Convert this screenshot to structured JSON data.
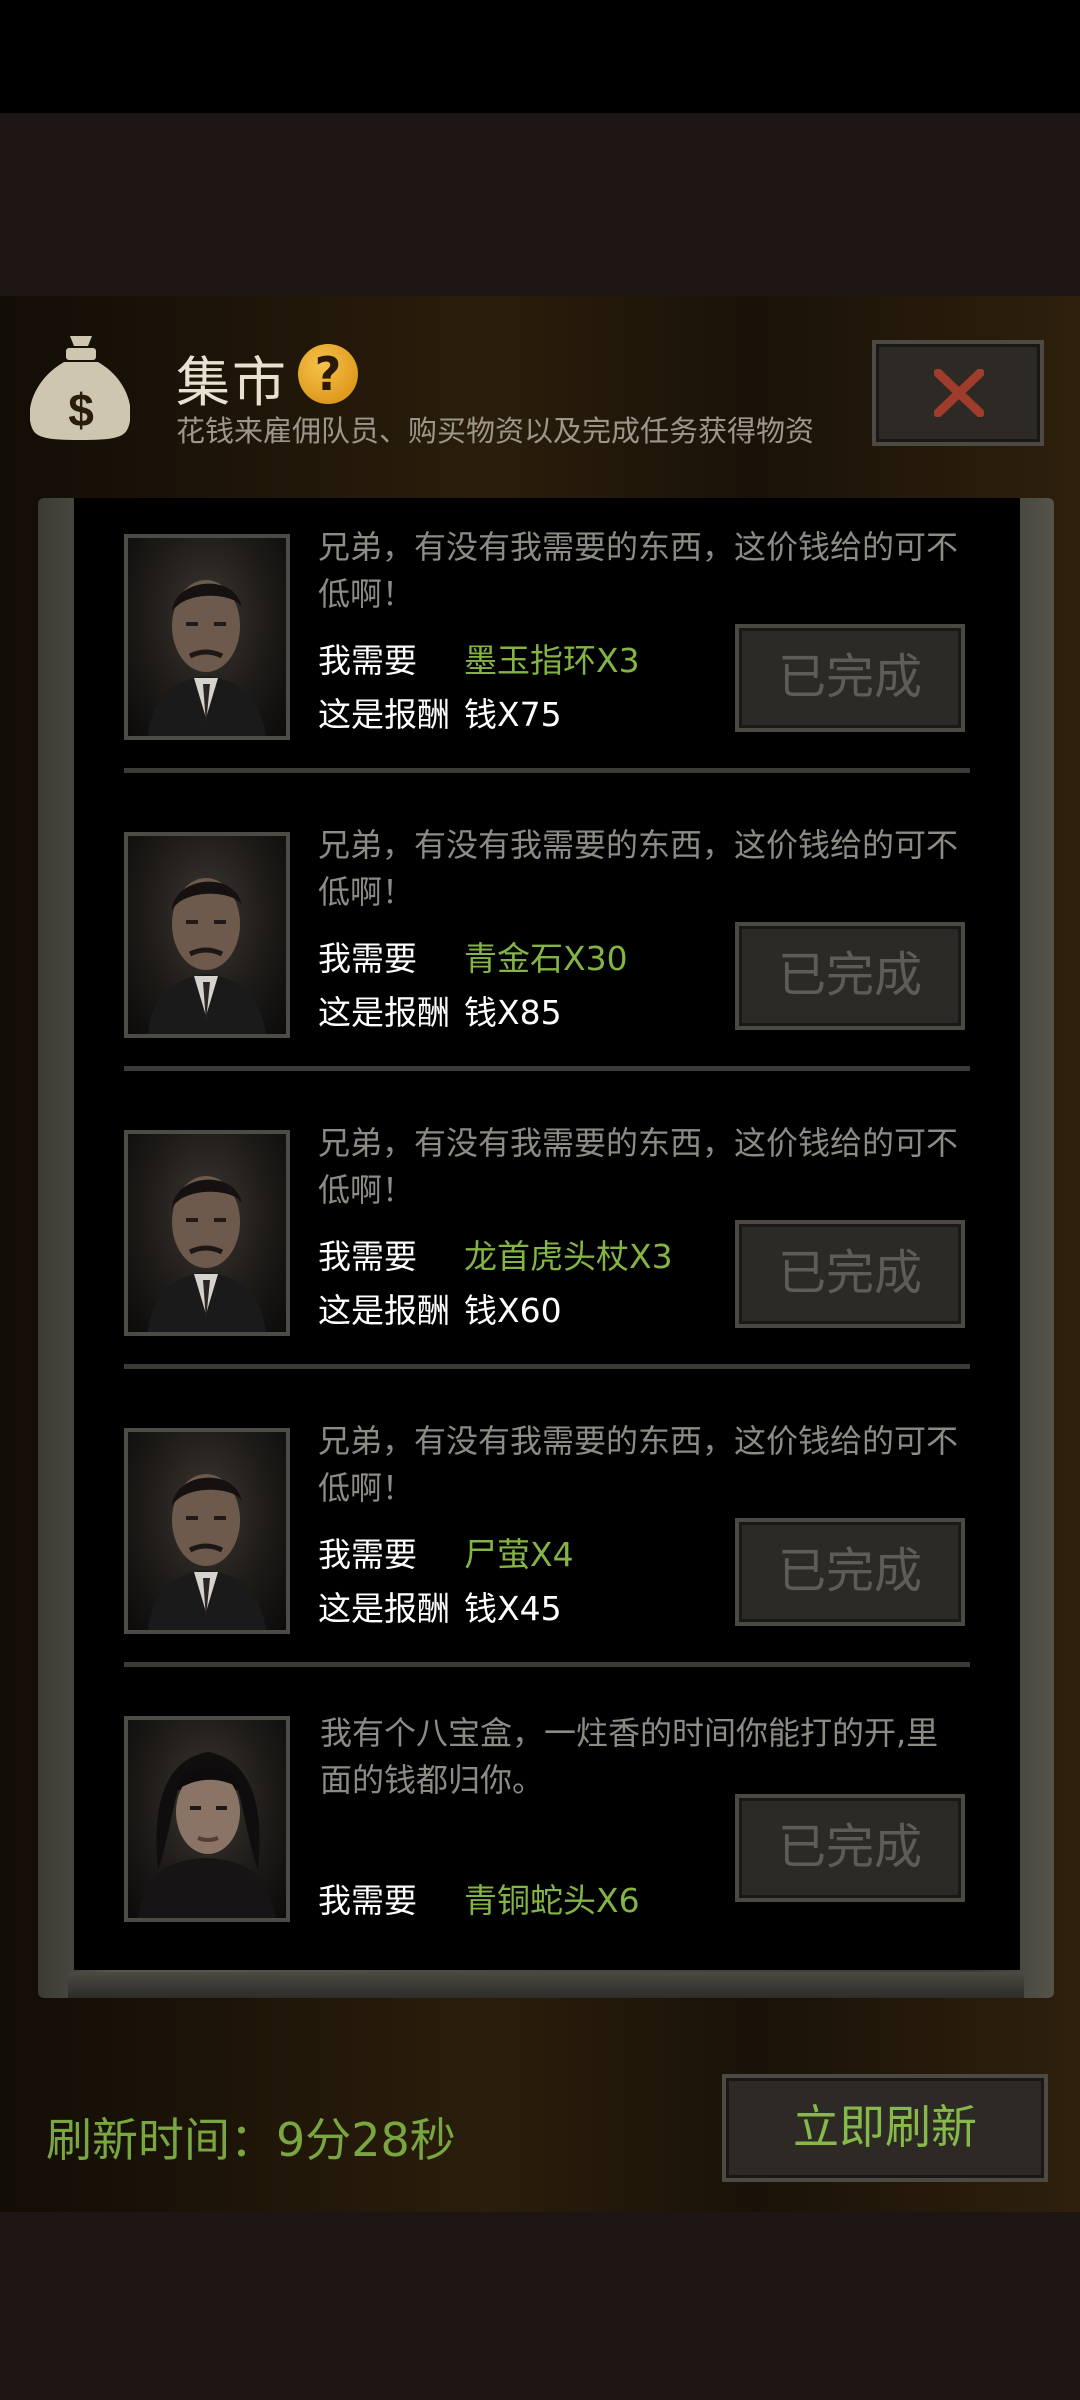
{
  "header": {
    "title": "集市",
    "help_glyph": "?",
    "subtitle": "花钱来雇佣队员、购买物资以及完成任务获得物资",
    "icon": "money-bag-icon",
    "close_icon": "close-icon"
  },
  "quests": [
    {
      "npc": "man-portrait",
      "speech": "兄弟，有没有我需要的东西，这价钱给的可不低啊！",
      "need_label": "我需要",
      "need_value": "墨玉指环X3",
      "reward_label": "这是报酬",
      "reward_value": "钱X75",
      "button": "已完成"
    },
    {
      "npc": "man-portrait",
      "speech": "兄弟，有没有我需要的东西，这价钱给的可不低啊！",
      "need_label": "我需要",
      "need_value": "青金石X30",
      "reward_label": "这是报酬",
      "reward_value": "钱X85",
      "button": "已完成"
    },
    {
      "npc": "man-portrait",
      "speech": "兄弟，有没有我需要的东西，这价钱给的可不低啊！",
      "need_label": "我需要",
      "need_value": "龙首虎头杖X3",
      "reward_label": "这是报酬",
      "reward_value": "钱X60",
      "button": "已完成"
    },
    {
      "npc": "man-portrait",
      "speech": "兄弟，有没有我需要的东西，这价钱给的可不低啊！",
      "need_label": "我需要",
      "need_value": "尸萤X4",
      "reward_label": "这是报酬",
      "reward_value": "钱X45",
      "button": "已完成"
    },
    {
      "npc": "woman-portrait",
      "speech": "我有个八宝盒，一炷香的时间你能打的开,里面的钱都归你。",
      "need_label": "我需要",
      "need_value": "青铜蛇头X6",
      "button": "已完成"
    }
  ],
  "footer": {
    "refresh_time": "刷新时间：9分28秒",
    "refresh_button": "立即刷新"
  },
  "colors": {
    "accent_green": "#84b444",
    "help_orange": "#f2b31f",
    "close_red": "#9c3a2a"
  }
}
